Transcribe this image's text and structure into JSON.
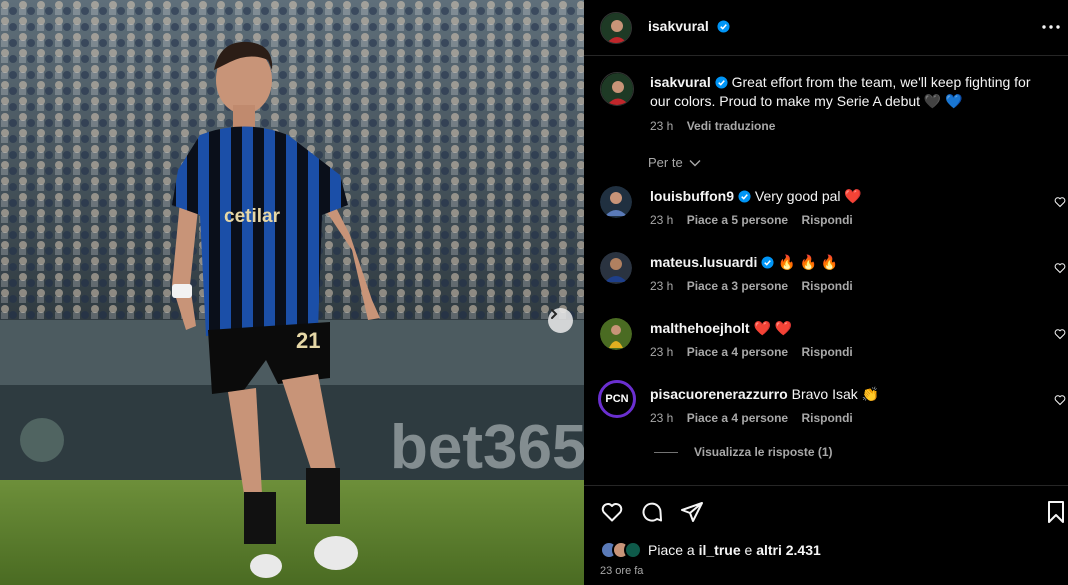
{
  "post": {
    "author": "isakvural",
    "more_icon": "more-horizontal-icon"
  },
  "caption": {
    "author": "isakvural",
    "text": "Great effort from the team, we'll keep fighting for our colors. Proud to make my Serie A debut",
    "emoji": "🖤 💙",
    "time": "23 h",
    "translate": "Vedi traduzione"
  },
  "filter_label": "Per te",
  "comments": [
    {
      "user": "louisbuffon9",
      "verified": true,
      "text": "Very good pal",
      "emoji": "❤️",
      "time": "23 h",
      "likes": "Piace a 5 persone",
      "reply": "Rispondi"
    },
    {
      "user": "mateus.lusuardi",
      "verified": true,
      "text": "",
      "emoji": "🔥 🔥 🔥",
      "time": "23 h",
      "likes": "Piace a 3 persone",
      "reply": "Rispondi"
    },
    {
      "user": "malthehoejholt",
      "verified": false,
      "text": "",
      "emoji": "❤️ ❤️",
      "time": "23 h",
      "likes": "Piace a 4 persone",
      "reply": "Rispondi"
    },
    {
      "user": "pisacuorenerazzurro",
      "verified": false,
      "text": "Bravo Isak",
      "emoji": "👏",
      "time": "23 h",
      "likes": "Piace a 4 persone",
      "reply": "Rispondi",
      "avatar_text": "PCN"
    }
  ],
  "view_replies": "Visualizza le risposte (1)",
  "likes": {
    "prefix": "Piace a",
    "user": "il_true",
    "middle": "e",
    "others": "altri 2.431"
  },
  "time_ago": "23 ore fa",
  "photo": {
    "jersey_sponsor": "cetilar",
    "jersey_number": "21",
    "board_text": "bet365"
  },
  "colors": {
    "verified": "#0095f6",
    "like_red": "#ff3040",
    "muted": "#a8a8a8"
  }
}
